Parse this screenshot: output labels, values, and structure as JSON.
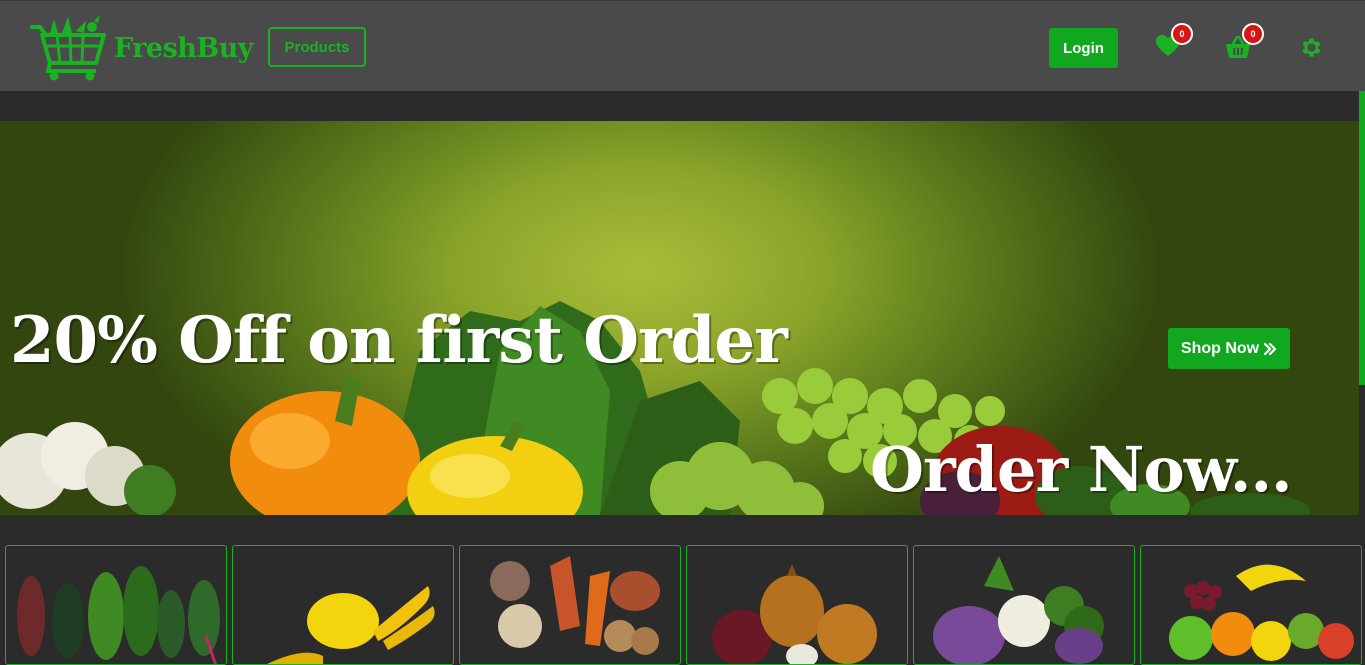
{
  "brand": {
    "name": "FreshBuy",
    "color": "#19b223"
  },
  "nav": {
    "products_label": "Products",
    "login_label": "Login",
    "wishlist": {
      "icon": "heart-icon",
      "count": "0"
    },
    "cart": {
      "icon": "basket-icon",
      "count": "0"
    },
    "settings": {
      "icon": "gear-icon"
    }
  },
  "hero": {
    "title": "20% Off on first Order",
    "subtitle": "Order Now...",
    "cta_label": "Shop Now",
    "cta_icon": "double-chevron-right-icon"
  },
  "categories": [
    {
      "image": "leafy-greens"
    },
    {
      "image": "yellow-squash-bananas"
    },
    {
      "image": "root-vegetables"
    },
    {
      "image": "onions-garlic"
    },
    {
      "image": "kohlrabi-cauliflower-broccoli"
    },
    {
      "image": "mixed-fruits"
    }
  ]
}
